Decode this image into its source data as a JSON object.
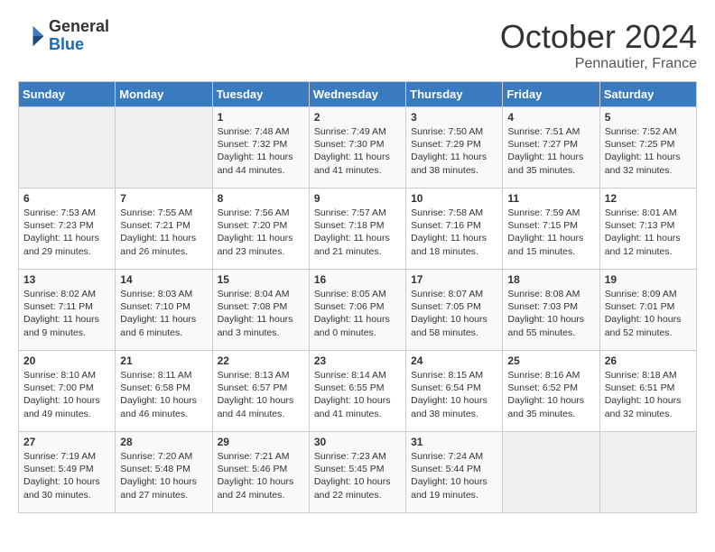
{
  "logo": {
    "general": "General",
    "blue": "Blue"
  },
  "title": "October 2024",
  "subtitle": "Pennautier, France",
  "headers": [
    "Sunday",
    "Monday",
    "Tuesday",
    "Wednesday",
    "Thursday",
    "Friday",
    "Saturday"
  ],
  "weeks": [
    [
      {
        "day": "",
        "empty": true
      },
      {
        "day": "",
        "empty": true
      },
      {
        "day": "1",
        "sunrise": "7:48 AM",
        "sunset": "7:32 PM",
        "daylight": "11 hours and 44 minutes."
      },
      {
        "day": "2",
        "sunrise": "7:49 AM",
        "sunset": "7:30 PM",
        "daylight": "11 hours and 41 minutes."
      },
      {
        "day": "3",
        "sunrise": "7:50 AM",
        "sunset": "7:29 PM",
        "daylight": "11 hours and 38 minutes."
      },
      {
        "day": "4",
        "sunrise": "7:51 AM",
        "sunset": "7:27 PM",
        "daylight": "11 hours and 35 minutes."
      },
      {
        "day": "5",
        "sunrise": "7:52 AM",
        "sunset": "7:25 PM",
        "daylight": "11 hours and 32 minutes."
      }
    ],
    [
      {
        "day": "6",
        "sunrise": "7:53 AM",
        "sunset": "7:23 PM",
        "daylight": "11 hours and 29 minutes."
      },
      {
        "day": "7",
        "sunrise": "7:55 AM",
        "sunset": "7:21 PM",
        "daylight": "11 hours and 26 minutes."
      },
      {
        "day": "8",
        "sunrise": "7:56 AM",
        "sunset": "7:20 PM",
        "daylight": "11 hours and 23 minutes."
      },
      {
        "day": "9",
        "sunrise": "7:57 AM",
        "sunset": "7:18 PM",
        "daylight": "11 hours and 21 minutes."
      },
      {
        "day": "10",
        "sunrise": "7:58 AM",
        "sunset": "7:16 PM",
        "daylight": "11 hours and 18 minutes."
      },
      {
        "day": "11",
        "sunrise": "7:59 AM",
        "sunset": "7:15 PM",
        "daylight": "11 hours and 15 minutes."
      },
      {
        "day": "12",
        "sunrise": "8:01 AM",
        "sunset": "7:13 PM",
        "daylight": "11 hours and 12 minutes."
      }
    ],
    [
      {
        "day": "13",
        "sunrise": "8:02 AM",
        "sunset": "7:11 PM",
        "daylight": "11 hours and 9 minutes."
      },
      {
        "day": "14",
        "sunrise": "8:03 AM",
        "sunset": "7:10 PM",
        "daylight": "11 hours and 6 minutes."
      },
      {
        "day": "15",
        "sunrise": "8:04 AM",
        "sunset": "7:08 PM",
        "daylight": "11 hours and 3 minutes."
      },
      {
        "day": "16",
        "sunrise": "8:05 AM",
        "sunset": "7:06 PM",
        "daylight": "11 hours and 0 minutes."
      },
      {
        "day": "17",
        "sunrise": "8:07 AM",
        "sunset": "7:05 PM",
        "daylight": "10 hours and 58 minutes."
      },
      {
        "day": "18",
        "sunrise": "8:08 AM",
        "sunset": "7:03 PM",
        "daylight": "10 hours and 55 minutes."
      },
      {
        "day": "19",
        "sunrise": "8:09 AM",
        "sunset": "7:01 PM",
        "daylight": "10 hours and 52 minutes."
      }
    ],
    [
      {
        "day": "20",
        "sunrise": "8:10 AM",
        "sunset": "7:00 PM",
        "daylight": "10 hours and 49 minutes."
      },
      {
        "day": "21",
        "sunrise": "8:11 AM",
        "sunset": "6:58 PM",
        "daylight": "10 hours and 46 minutes."
      },
      {
        "day": "22",
        "sunrise": "8:13 AM",
        "sunset": "6:57 PM",
        "daylight": "10 hours and 44 minutes."
      },
      {
        "day": "23",
        "sunrise": "8:14 AM",
        "sunset": "6:55 PM",
        "daylight": "10 hours and 41 minutes."
      },
      {
        "day": "24",
        "sunrise": "8:15 AM",
        "sunset": "6:54 PM",
        "daylight": "10 hours and 38 minutes."
      },
      {
        "day": "25",
        "sunrise": "8:16 AM",
        "sunset": "6:52 PM",
        "daylight": "10 hours and 35 minutes."
      },
      {
        "day": "26",
        "sunrise": "8:18 AM",
        "sunset": "6:51 PM",
        "daylight": "10 hours and 32 minutes."
      }
    ],
    [
      {
        "day": "27",
        "sunrise": "7:19 AM",
        "sunset": "5:49 PM",
        "daylight": "10 hours and 30 minutes."
      },
      {
        "day": "28",
        "sunrise": "7:20 AM",
        "sunset": "5:48 PM",
        "daylight": "10 hours and 27 minutes."
      },
      {
        "day": "29",
        "sunrise": "7:21 AM",
        "sunset": "5:46 PM",
        "daylight": "10 hours and 24 minutes."
      },
      {
        "day": "30",
        "sunrise": "7:23 AM",
        "sunset": "5:45 PM",
        "daylight": "10 hours and 22 minutes."
      },
      {
        "day": "31",
        "sunrise": "7:24 AM",
        "sunset": "5:44 PM",
        "daylight": "10 hours and 19 minutes."
      },
      {
        "day": "",
        "empty": true
      },
      {
        "day": "",
        "empty": true
      }
    ]
  ]
}
